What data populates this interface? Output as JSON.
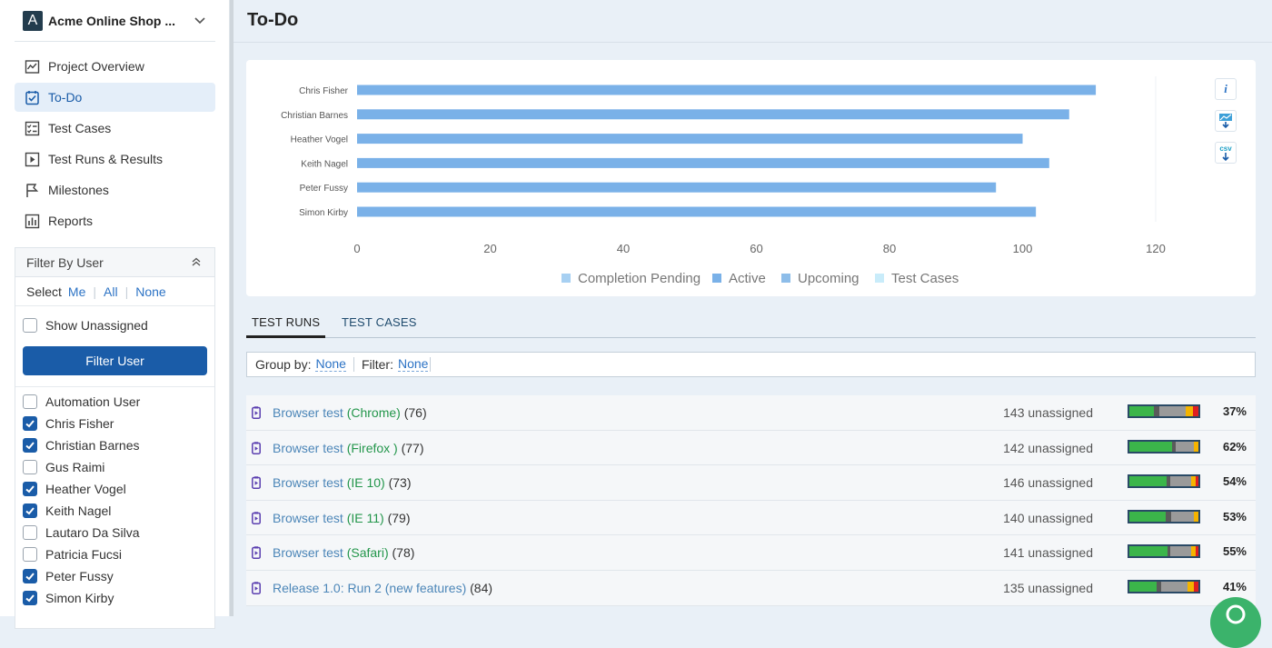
{
  "project": {
    "logo_letter": "A",
    "name": "Acme Online Shop ..."
  },
  "nav": [
    {
      "label": "Project Overview",
      "icon": "chart-line-icon"
    },
    {
      "label": "To-Do",
      "icon": "checkbox-icon",
      "active": true
    },
    {
      "label": "Test Cases",
      "icon": "checklist-icon"
    },
    {
      "label": "Test Runs & Results",
      "icon": "play-icon"
    },
    {
      "label": "Milestones",
      "icon": "flag-icon"
    },
    {
      "label": "Reports",
      "icon": "bar-chart-icon"
    }
  ],
  "filter": {
    "title": "Filter By User",
    "select_label": "Select",
    "select_me": "Me",
    "select_all": "All",
    "select_none": "None",
    "show_unassigned": "Show Unassigned",
    "show_unassigned_checked": false,
    "button_label": "Filter User",
    "users": [
      {
        "name": "Automation User",
        "checked": false
      },
      {
        "name": "Chris Fisher",
        "checked": true
      },
      {
        "name": "Christian Barnes",
        "checked": true
      },
      {
        "name": "Gus Raimi",
        "checked": false
      },
      {
        "name": "Heather Vogel",
        "checked": true
      },
      {
        "name": "Keith Nagel",
        "checked": true
      },
      {
        "name": "Lautaro Da Silva",
        "checked": false
      },
      {
        "name": "Patricia Fucsi",
        "checked": false
      },
      {
        "name": "Peter Fussy",
        "checked": true
      },
      {
        "name": "Simon Kirby",
        "checked": true
      }
    ]
  },
  "page": {
    "title": "To-Do"
  },
  "chart_data": {
    "type": "bar",
    "orientation": "horizontal",
    "categories": [
      "Chris Fisher",
      "Christian Barnes",
      "Heather Vogel",
      "Keith Nagel",
      "Peter Fussy",
      "Simon Kirby"
    ],
    "series": [
      {
        "name": "Completion Pending",
        "values": [
          0,
          0,
          0,
          0,
          0,
          0
        ],
        "color": "#a7d0f2"
      },
      {
        "name": "Active",
        "values": [
          111,
          107,
          100,
          104,
          96,
          102
        ],
        "color": "#7ab1e8"
      },
      {
        "name": "Upcoming",
        "values": [
          0,
          0,
          0,
          0,
          0,
          0
        ],
        "color": "#8dbde9"
      },
      {
        "name": "Test Cases",
        "values": [
          0,
          0,
          0,
          0,
          0,
          0
        ],
        "color": "#c9ecfa"
      }
    ],
    "xlim": [
      0,
      120
    ],
    "xticks": [
      0,
      20,
      40,
      60,
      80,
      100,
      120
    ],
    "grid": false,
    "legend_position": "bottom",
    "title": "",
    "xlabel": "",
    "ylabel": ""
  },
  "chart_tools": {
    "info_label": "i",
    "csv_label": "csv"
  },
  "tabs": [
    {
      "label": "TEST RUNS",
      "active": true
    },
    {
      "label": "TEST CASES",
      "active": false
    }
  ],
  "filter_bar": {
    "group_label": "Group by:",
    "group_value": "None",
    "filter_label": "Filter:",
    "filter_value": "None"
  },
  "runs": [
    {
      "name": "Browser test",
      "config": "(Chrome)",
      "count": "(76)",
      "unassigned": "143 unassigned",
      "percent": "37%",
      "segments": [
        {
          "color": "#3bb54a",
          "value": 0.35
        },
        {
          "color": "#5a5a5a",
          "value": 0.09
        },
        {
          "color": "#9a9a9a",
          "value": 0.38
        },
        {
          "color": "#f5b400",
          "value": 0.1
        },
        {
          "color": "#e02020",
          "value": 0.08
        }
      ]
    },
    {
      "name": "Browser test",
      "config": "(Firefox )",
      "count": "(77)",
      "unassigned": "142 unassigned",
      "percent": "62%",
      "segments": [
        {
          "color": "#3bb54a",
          "value": 0.62
        },
        {
          "color": "#5a5a5a",
          "value": 0.05
        },
        {
          "color": "#9a9a9a",
          "value": 0.26
        },
        {
          "color": "#f5b400",
          "value": 0.07
        }
      ]
    },
    {
      "name": "Browser test",
      "config": "(IE 10)",
      "count": "(73)",
      "unassigned": "146 unassigned",
      "percent": "54%",
      "segments": [
        {
          "color": "#3bb54a",
          "value": 0.54
        },
        {
          "color": "#5a5a5a",
          "value": 0.05
        },
        {
          "color": "#9a9a9a",
          "value": 0.3
        },
        {
          "color": "#f5b400",
          "value": 0.07
        },
        {
          "color": "#e02020",
          "value": 0.04
        }
      ]
    },
    {
      "name": "Browser test",
      "config": "(IE 11)",
      "count": "(79)",
      "unassigned": "140 unassigned",
      "percent": "53%",
      "segments": [
        {
          "color": "#3bb54a",
          "value": 0.53
        },
        {
          "color": "#5a5a5a",
          "value": 0.07
        },
        {
          "color": "#9a9a9a",
          "value": 0.33
        },
        {
          "color": "#f5b400",
          "value": 0.07
        }
      ]
    },
    {
      "name": "Browser test",
      "config": "(Safari)",
      "count": "(78)",
      "unassigned": "141 unassigned",
      "percent": "55%",
      "segments": [
        {
          "color": "#3bb54a",
          "value": 0.55
        },
        {
          "color": "#5a5a5a",
          "value": 0.04
        },
        {
          "color": "#9a9a9a",
          "value": 0.3
        },
        {
          "color": "#f5b400",
          "value": 0.07
        },
        {
          "color": "#e02020",
          "value": 0.04
        }
      ]
    },
    {
      "name": "Release 1.0: Run 2 (new features)",
      "config": "",
      "count": "(84)",
      "unassigned": "135 unassigned",
      "percent": "41%",
      "segments": [
        {
          "color": "#3bb54a",
          "value": 0.4
        },
        {
          "color": "#5a5a5a",
          "value": 0.06
        },
        {
          "color": "#9a9a9a",
          "value": 0.38
        },
        {
          "color": "#f5b400",
          "value": 0.1
        },
        {
          "color": "#e02020",
          "value": 0.06
        }
      ]
    }
  ],
  "colors": {
    "accent": "#1a5ca8",
    "link": "#2c73c5",
    "config_green": "#23964b"
  }
}
